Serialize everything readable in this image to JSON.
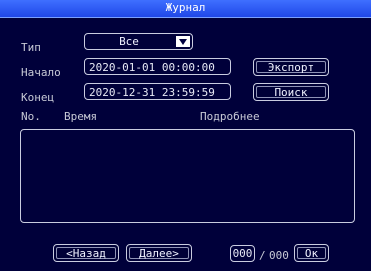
{
  "window": {
    "title": "Журнал"
  },
  "filter": {
    "type_label": "Тип",
    "type_value": "Все",
    "start_label": "Начало",
    "start_value": "2020-01-01 00:00:00",
    "end_label": "Конец",
    "end_value": "2020-12-31 23:59:59"
  },
  "actions": {
    "export_label": "Экспорт",
    "search_label": "Поиск"
  },
  "table": {
    "columns": [
      "No.",
      "Время",
      "Подробнее"
    ],
    "rows": []
  },
  "pagination": {
    "prev_label": "<Назад",
    "next_label": "Далее>",
    "current_page": "000",
    "separator": "/",
    "total_pages": "000",
    "ok_label": "Ок"
  },
  "colors": {
    "background": "#00003a",
    "title_bar": "#2d57f2",
    "border": "#c9cce0",
    "text": "#c8cce0"
  }
}
